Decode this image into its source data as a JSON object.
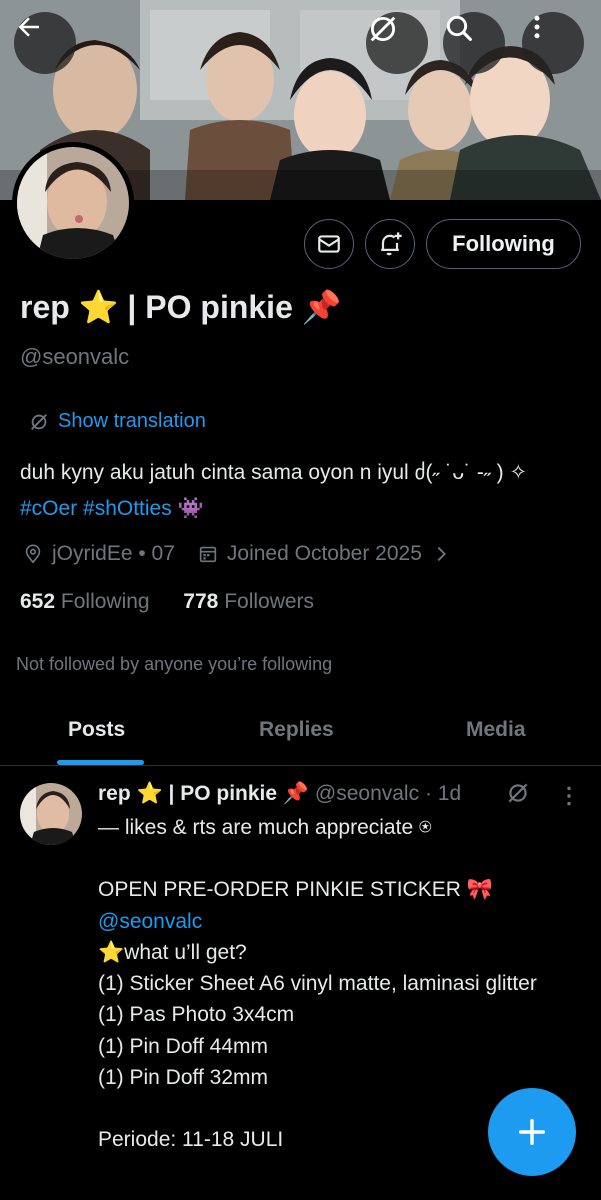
{
  "profile": {
    "display_name": "rep ⭐ | PO pinkie 📌",
    "handle": "@seonvalc",
    "show_translation": "Show translation",
    "bio_text": "duh kyny aku jatuh cinta sama oyon n iyul ძ(˶ ˙ᴗ˙ -˶ ) ✧ ",
    "bio_tags": [
      "#cOer",
      "#shOtties"
    ],
    "bio_emoji": "👾",
    "location": "jOyridEe • 07",
    "joined": "Joined October 2025",
    "following_count": "652",
    "following_label": "Following",
    "followers_count": "778",
    "followers_label": "Followers",
    "not_followed_note": "Not followed by anyone you’re following"
  },
  "actions": {
    "follow_button_label": "Following"
  },
  "icons": {
    "back": "back-arrow-icon",
    "no_translate": "translate-off-icon",
    "search": "search-icon",
    "more": "more-vertical-icon",
    "message": "message-icon",
    "notify": "notification-add-icon",
    "location": "location-pin-icon",
    "calendar": "calendar-icon",
    "chevron": "chevron-right-icon",
    "compose": "plus-icon"
  },
  "tabs": [
    {
      "label": "Posts",
      "active": true
    },
    {
      "label": "Replies",
      "active": false
    },
    {
      "label": "Media",
      "active": false
    }
  ],
  "post": {
    "author_name": "rep ⭐ | PO pinkie 📌",
    "author_handle": "@seonvalc",
    "time": "· 1d",
    "line1": "— likes & rts are much appreciate ⍟",
    "line2": "OPEN PRE-ORDER PINKIE STICKER 🎀",
    "mention": "@seonvalc",
    "line3": "⭐what u’ll get?",
    "line4": "(1) Sticker Sheet A6 vinyl matte, laminasi glitter",
    "line5": "(1) Pas Photo 3x4cm",
    "line6": "(1) Pin Doff 44mm",
    "line7": "(1) Pin Doff 32mm",
    "line8": "Periode: 11-18 JULI"
  },
  "colors": {
    "accent": "#1d9bf0",
    "background": "#000000",
    "text_primary": "#e7e9ea",
    "text_secondary": "#71767b",
    "border": "#536471"
  }
}
